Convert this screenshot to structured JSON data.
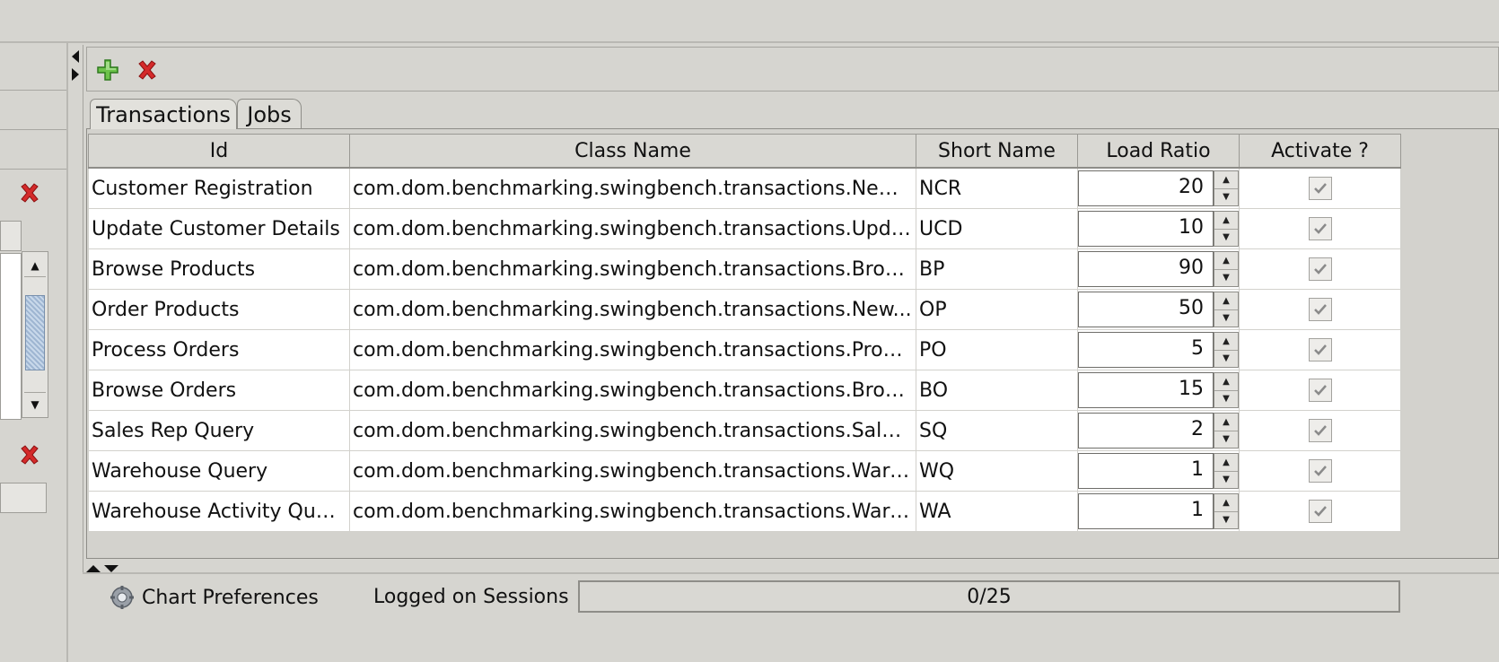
{
  "toolbar": {
    "add_icon": "plus-icon",
    "remove_icon": "delete-x-icon"
  },
  "tabs": [
    {
      "label": "Transactions",
      "active": true
    },
    {
      "label": "Jobs",
      "active": false
    }
  ],
  "table": {
    "columns": [
      "Id",
      "Class Name",
      "Short Name",
      "Load Ratio",
      "Activate ?"
    ],
    "rows": [
      {
        "id": "Customer Registration",
        "class_name": "com.dom.benchmarking.swingbench.transactions.NewC...",
        "short_name": "NCR",
        "load_ratio": "20",
        "active": true
      },
      {
        "id": "Update Customer Details",
        "class_name": "com.dom.benchmarking.swingbench.transactions.Upda...",
        "short_name": "UCD",
        "load_ratio": "10",
        "active": true
      },
      {
        "id": "Browse Products",
        "class_name": "com.dom.benchmarking.swingbench.transactions.Brow...",
        "short_name": "BP",
        "load_ratio": "90",
        "active": true
      },
      {
        "id": "Order Products",
        "class_name": "com.dom.benchmarking.swingbench.transactions.New...",
        "short_name": "OP",
        "load_ratio": "50",
        "active": true
      },
      {
        "id": "Process Orders",
        "class_name": "com.dom.benchmarking.swingbench.transactions.Proce...",
        "short_name": "PO",
        "load_ratio": "5",
        "active": true
      },
      {
        "id": "Browse Orders",
        "class_name": "com.dom.benchmarking.swingbench.transactions.Brow...",
        "short_name": "BO",
        "load_ratio": "15",
        "active": true
      },
      {
        "id": "Sales Rep Query",
        "class_name": "com.dom.benchmarking.swingbench.transactions.Sales...",
        "short_name": "SQ",
        "load_ratio": "2",
        "active": true
      },
      {
        "id": "Warehouse Query",
        "class_name": "com.dom.benchmarking.swingbench.transactions.Ware...",
        "short_name": "WQ",
        "load_ratio": "1",
        "active": true
      },
      {
        "id": "Warehouse Activity Query",
        "class_name": "com.dom.benchmarking.swingbench.transactions.Ware...",
        "short_name": "WA",
        "load_ratio": "1",
        "active": true
      }
    ]
  },
  "statusbar": {
    "chart_prefs_label": "Chart Preferences",
    "sessions_label": "Logged on Sessions",
    "sessions_value": "0/25"
  },
  "colors": {
    "delete_red": "#d42a2a",
    "add_green": "#3c9a2e"
  }
}
